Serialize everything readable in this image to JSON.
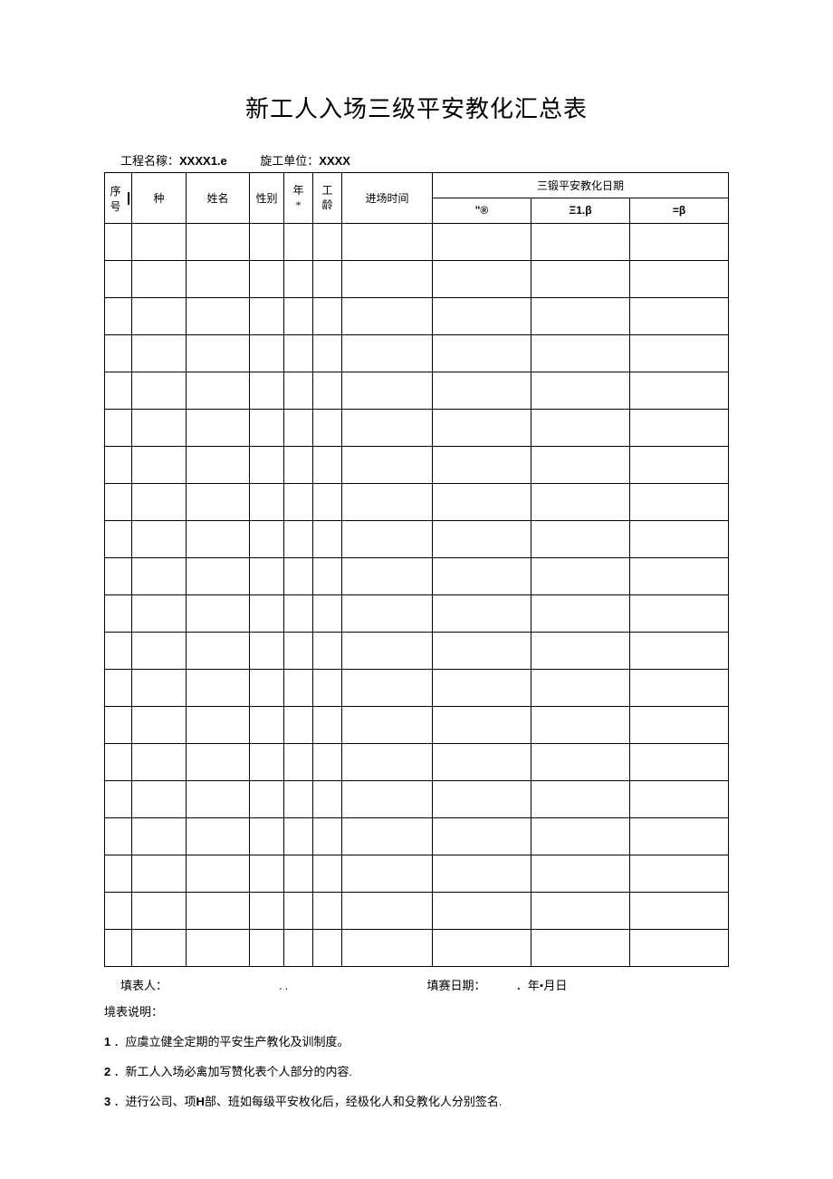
{
  "title": "新工人入场三级平安教化汇总表",
  "header": {
    "project_label": "工程名稼：",
    "project_value": "XXXX1.e",
    "unit_label": "旋工单位：",
    "unit_value": "XXXX"
  },
  "table": {
    "columns": {
      "seq": "序号",
      "kind": "种",
      "name": "姓名",
      "sex": "性别",
      "age_line1": "年",
      "age_line2": "*",
      "exp_line1": "工",
      "exp_line2": "龄",
      "entry": "进场时间",
      "group_label": "三锻平安教化日期",
      "level1": "\"®",
      "level2": "Ξ1.β",
      "level3": "=β"
    },
    "row_count": 20
  },
  "footer": {
    "filler_label": "填表人：",
    "filler_dots": ". .",
    "date_label": "填赛日期：",
    "date_value": "．年•月日"
  },
  "notes_title": "境表说明：",
  "notes": [
    {
      "num": "1",
      "sep": " ．",
      "text": "应虞立健全定期的平安生产教化及训制度。"
    },
    {
      "num": "2",
      "sep": " ．",
      "text": "新工人入场必禽加写赞化表个人部分的内容."
    },
    {
      "num": "3",
      "sep": " ．",
      "text_a": "进行公司、项",
      "bold": "H",
      "text_b": "部、班如每级平安枚化后，经极化人和殳教化人分别签名."
    }
  ]
}
